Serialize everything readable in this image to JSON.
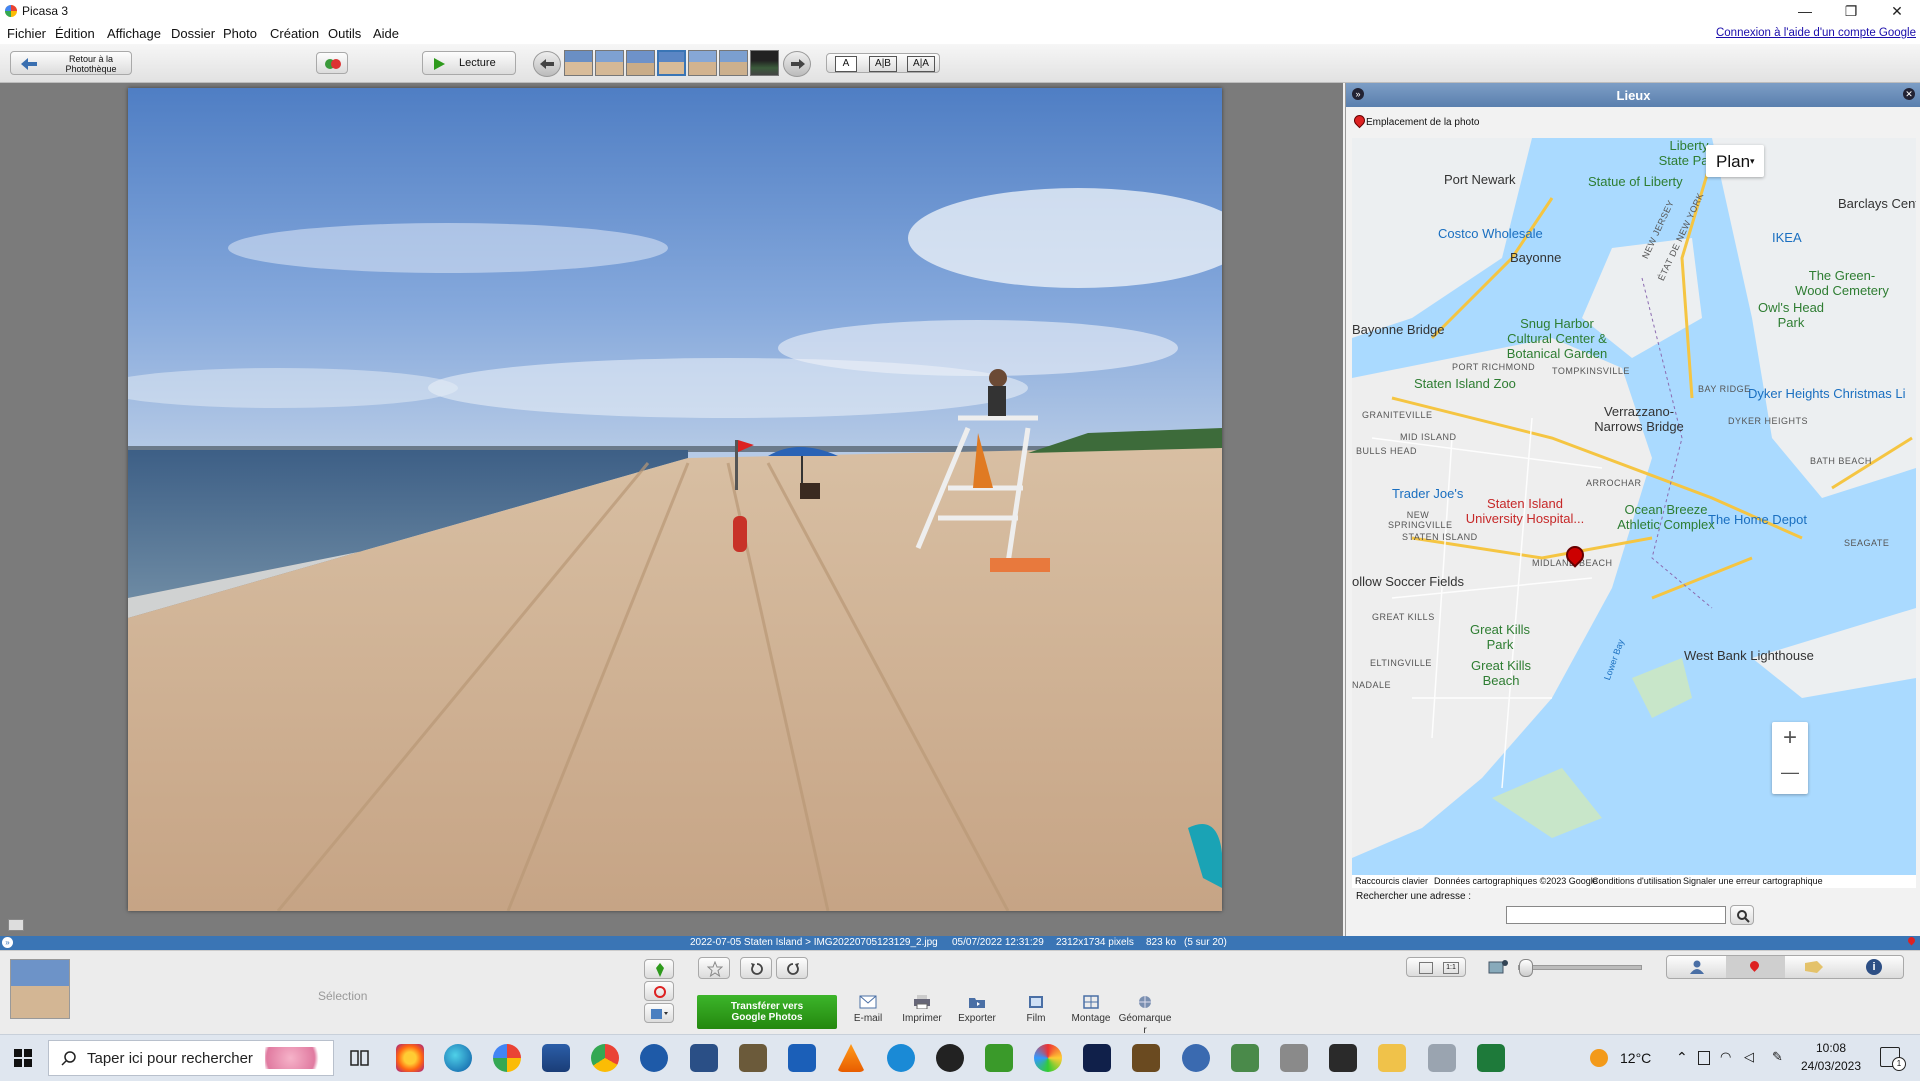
{
  "window": {
    "title": "Picasa 3",
    "min_glyph": "—",
    "max_glyph": "❐",
    "close_glyph": "✕"
  },
  "menu": {
    "items": [
      "Fichier",
      "Édition",
      "Affichage",
      "Dossier",
      "Photo",
      "Création",
      "Outils",
      "Aide"
    ],
    "account_link": "Connexion à l'aide d'un compte Google"
  },
  "toolbar": {
    "back_label_line1": "Retour à la",
    "back_label_line2": "Photothèque",
    "play_label": "Lecture",
    "caption_modes": [
      "A",
      "A|B",
      "A|A"
    ]
  },
  "places": {
    "title": "Lieux",
    "photo_location_label": "Emplacement de la photo",
    "map_type_label": "Plan",
    "map_type_arrow": "▾",
    "zoom_in": "+",
    "zoom_out": "—",
    "map_labels": [
      {
        "text": "Liberty State Park",
        "cls": "green"
      },
      {
        "text": "Port Newark",
        "cls": ""
      },
      {
        "text": "Statue of Liberty",
        "cls": "green"
      },
      {
        "text": "Barclays Cent",
        "cls": ""
      },
      {
        "text": "Costco Wholesale",
        "cls": "blue"
      },
      {
        "text": "IKEA",
        "cls": "blue"
      },
      {
        "text": "Bayonne",
        "cls": ""
      },
      {
        "text": "NEW JERSEY",
        "cls": "small"
      },
      {
        "text": "ÉTAT DE NEW YORK",
        "cls": "small"
      },
      {
        "text": "The Green-Wood Cemetery",
        "cls": "green"
      },
      {
        "text": "Bayonne Bridge",
        "cls": ""
      },
      {
        "text": "Snug Harbor Cultural Center & Botanical Garden",
        "cls": "green"
      },
      {
        "text": "Owl's Head Park",
        "cls": "green"
      },
      {
        "text": "PORT RICHMOND",
        "cls": "small"
      },
      {
        "text": "TOMPKINSVILLE",
        "cls": "small"
      },
      {
        "text": "Staten Island Zoo",
        "cls": "green"
      },
      {
        "text": "GRANITEVILLE",
        "cls": "small"
      },
      {
        "text": "Verrazzano-Narrows Bridge",
        "cls": ""
      },
      {
        "text": "Dyker Heights Christmas Li",
        "cls": "blue"
      },
      {
        "text": "MID ISLAND",
        "cls": "small"
      },
      {
        "text": "BAY RIDGE",
        "cls": "small"
      },
      {
        "text": "DYKER HEIGHTS",
        "cls": "small"
      },
      {
        "text": "BULLS HEAD",
        "cls": "small"
      },
      {
        "text": "ARROCHAR",
        "cls": "small"
      },
      {
        "text": "BATH BEACH",
        "cls": "small"
      },
      {
        "text": "Trader Joe's",
        "cls": "blue"
      },
      {
        "text": "Staten Island University Hospital...",
        "cls": "red"
      },
      {
        "text": "Ocean Breeze Athletic Complex",
        "cls": "green"
      },
      {
        "text": "The Home Depot",
        "cls": "blue"
      },
      {
        "text": "NEW SPRINGVILLE",
        "cls": "small"
      },
      {
        "text": "STATEN ISLAND",
        "cls": "small"
      },
      {
        "text": "SEAGATE",
        "cls": "small"
      },
      {
        "text": "MIDLAND BEACH",
        "cls": "small"
      },
      {
        "text": "ollow Soccer Fields",
        "cls": ""
      },
      {
        "text": "GREAT KILLS",
        "cls": "small"
      },
      {
        "text": "Great Kills Park",
        "cls": "green"
      },
      {
        "text": "ELTINGVILLE",
        "cls": "small"
      },
      {
        "text": "Great Kills Beach",
        "cls": "green"
      },
      {
        "text": "West Bank Lighthouse",
        "cls": ""
      },
      {
        "text": "NADALE",
        "cls": "small"
      },
      {
        "text": "Lower Bay",
        "cls": "blue"
      }
    ],
    "map_footer": [
      "Raccourcis clavier",
      "Données cartographiques ©2023 Google",
      "Conditions d'utilisation",
      "Signaler une erreur cartographique"
    ],
    "search_label": "Rechercher une adresse :",
    "search_value": ""
  },
  "status": {
    "path": "2022-07-05 Staten Island > IMG20220705123129_2.jpg",
    "date": "05/07/2022 12:31:29",
    "dimensions": "2312x1734 pixels",
    "size": "823 ko",
    "position": "(5 sur 20)"
  },
  "bottom": {
    "selection_label": "Sélection",
    "upload_label_line1": "Transférer vers",
    "upload_label_line2": "Google Photos",
    "actions": [
      "E-mail",
      "Imprimer",
      "Exporter",
      "Film",
      "Montage",
      "Géomarque r"
    ]
  },
  "taskbar": {
    "search_placeholder": "Taper ici pour rechercher",
    "weather": "12°C",
    "time": "10:08",
    "date": "24/03/2023",
    "notification_count": "1"
  },
  "colors": {
    "accent": "#3a75b5",
    "upload_green": "#2e9a1c",
    "map_water": "#aadaff",
    "map_land": "#eeeeee"
  }
}
